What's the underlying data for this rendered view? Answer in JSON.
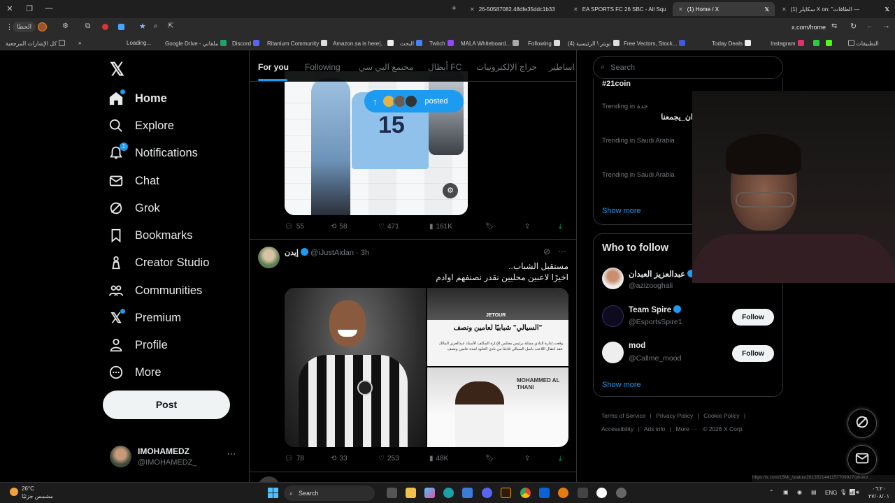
{
  "browser": {
    "tabs": [
      {
        "title": "26-50587082.48dfe35ddc1b33",
        "active": false
      },
      {
        "title": "EA SPORTS FC 26 SBC - All Squ",
        "active": false
      },
      {
        "title": "(1) Home / X",
        "active": true
      },
      {
        "title": "(1) سكايلر X on: \"‏ — الطاقات",
        "active": false
      }
    ],
    "address": "x.com/home",
    "profile_label": "الحطا",
    "bookmarks": [
      "كل الإشارات المرجعية",
      "Loading...",
      "Google Drive - ملفاتي",
      "Discord",
      "Ritanium Community",
      "Amazon.sa is here|...",
      "البحث",
      "Twitch",
      "MALA Whiteboard...",
      "Following",
      "(4) تويتر \\ الرئيسية",
      "Free Vectors, Stock...",
      "Today Deals",
      "Instagram",
      "التطبيقات"
    ]
  },
  "sidebar": {
    "items": [
      {
        "label": "Home",
        "icon": "home-icon"
      },
      {
        "label": "Explore",
        "icon": "search-icon"
      },
      {
        "label": "Notifications",
        "icon": "bell-icon",
        "badge": "1"
      },
      {
        "label": "Chat",
        "icon": "mail-icon"
      },
      {
        "label": "Grok",
        "icon": "grok-icon"
      },
      {
        "label": "Bookmarks",
        "icon": "bookmark-icon"
      },
      {
        "label": "Creator Studio",
        "icon": "creator-studio-icon"
      },
      {
        "label": "Communities",
        "icon": "communities-icon"
      },
      {
        "label": "Premium",
        "icon": "x-logo-icon"
      },
      {
        "label": "Profile",
        "icon": "person-icon"
      },
      {
        "label": "More",
        "icon": "more-circle-icon"
      }
    ],
    "post_label": "Post",
    "account": {
      "name": "IMOHAMEDZ",
      "handle": "@IMOHAMEDZ_"
    }
  },
  "feed": {
    "tabs": [
      "For you",
      "Following",
      "مجتمع البي سي",
      "أبطال FC",
      "حراج الإلكترونيات",
      "اساطير"
    ],
    "new_posts_pill": "posted",
    "post1": {
      "jersey": "15",
      "replies": "55",
      "reposts": "58",
      "likes": "471",
      "views": "161K"
    },
    "post2": {
      "name": "إيدن",
      "handle": "@iJustAidan · 3h",
      "text_line1": "مستقبل الشباب..",
      "text_line2": "اخيرًا لاعبين محليين نقدر نصنفهم اوادم",
      "img_title": "\"السيالي\" شبابيًا لعامين ونصف",
      "img_body": "وقعت إدارة النادي ممثلة برئيس مجلس الإدارة المكلف الأستاذ عبدالعزيز المالك عقد انتقال اللاعب باسل السيالي قادمًا من نادي الخلود لمدة عامين ونصف",
      "img_player": "MOHAMMED AL THANI",
      "img_sponsor": "JETOUR",
      "replies": "78",
      "reposts": "33",
      "likes": "253",
      "views": "48K"
    }
  },
  "right": {
    "search_placeholder": "Search",
    "trends": [
      {
        "meta": "",
        "title": "#21coin"
      },
      {
        "meta": "Trending in جدة",
        "title": "ان_يجمعنا"
      },
      {
        "meta": "Trending in Saudi Arabia",
        "title": ""
      },
      {
        "meta": "Trending in Saudi Arabia",
        "title": ""
      }
    ],
    "show_more": "Show more",
    "who_to_follow_title": "Who to follow",
    "suggestions": [
      {
        "name": "عبدالعزيز العبدان",
        "handle": "@azizooghali"
      },
      {
        "name": "Team Spire",
        "handle": "@EsportsSpire1",
        "button": "Follow"
      },
      {
        "name": "mod",
        "handle": "@Callme_mood",
        "button": "Follow"
      }
    ],
    "footer_links": [
      "Terms of Service",
      "Privacy Policy",
      "Cookie Policy",
      "Accessibility",
      "Ads info",
      "More ···",
      "© 2026 X Corp."
    ]
  },
  "statusbar_url": "https://x.com/15Mi_/status/2013521441157709927/photo/...",
  "taskbar": {
    "weather_temp": "26°C",
    "weather_desc": "مشمس جزئيًا",
    "search": "Search",
    "lang": "ENG",
    "time": "٠٦:٢٠",
    "date": "٢٧/٠٨/٠١"
  },
  "colors": {
    "accent": "#1d9bf0",
    "background": "#000000",
    "border": "#2f3336",
    "muted": "#71767b"
  }
}
